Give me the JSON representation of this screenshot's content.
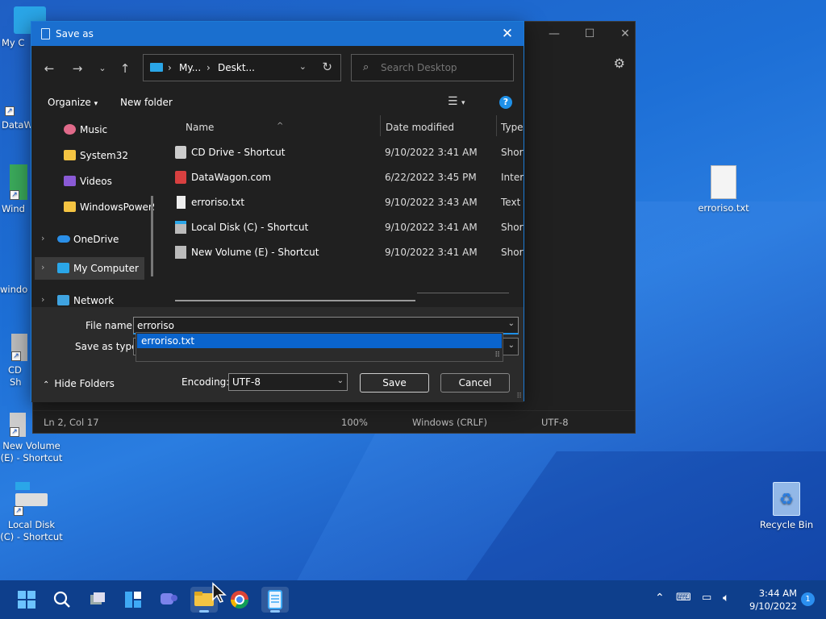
{
  "desktop": {
    "icons": [
      {
        "label": "My Computer",
        "partial": "My C"
      },
      {
        "label": "DataWagon.com",
        "partial": "DataW"
      },
      {
        "label": "WindowsPowerShell",
        "partial": "Wind"
      },
      {
        "label": "windows",
        "partial": "windo"
      },
      {
        "label": "CD Drive - Shortcut",
        "partial1": "CD",
        "partial2": "Sh"
      },
      {
        "label": "New Volume (E) - Shortcut"
      },
      {
        "label": "Local Disk (C) - Shortcut"
      },
      {
        "label": "erroriso.txt"
      },
      {
        "label": "Recycle Bin"
      }
    ]
  },
  "notepad": {
    "status": {
      "position": "Ln 2, Col 17",
      "zoom": "100%",
      "line_endings": "Windows (CRLF)",
      "encoding": "UTF-8"
    }
  },
  "dialog": {
    "title": "Save as",
    "address": {
      "crumb1": "My...",
      "crumb2": "Deskt..."
    },
    "search_placeholder": "Search Desktop",
    "commands": {
      "organize": "Organize",
      "new_folder": "New folder"
    },
    "nav_items": [
      {
        "label": "Music",
        "icon": "music-icon"
      },
      {
        "label": "System32",
        "icon": "folder-icon"
      },
      {
        "label": "Videos",
        "icon": "videos-icon"
      },
      {
        "label": "WindowsPowerShell",
        "icon": "folder-icon"
      },
      {
        "label": "OneDrive",
        "icon": "onedrive-icon"
      },
      {
        "label": "My Computer",
        "icon": "computer-icon"
      },
      {
        "label": "Network",
        "icon": "network-icon"
      }
    ],
    "columns": {
      "name": "Name",
      "date": "Date modified",
      "type": "Type"
    },
    "files": [
      {
        "name": "CD Drive - Shortcut",
        "date": "9/10/2022 3:41 AM",
        "type": "Short"
      },
      {
        "name": "DataWagon.com",
        "date": "6/22/2022 3:45 PM",
        "type": "Intern"
      },
      {
        "name": "erroriso.txt",
        "date": "9/10/2022 3:43 AM",
        "type": "Text D"
      },
      {
        "name": "Local Disk (C) - Shortcut",
        "date": "9/10/2022 3:41 AM",
        "type": "Short"
      },
      {
        "name": "New Volume (E) - Shortcut",
        "date": "9/10/2022 3:41 AM",
        "type": "Short"
      }
    ],
    "file_name_label": "File name:",
    "file_name_value": "erroriso",
    "save_as_type_label": "Save as type:",
    "autocomplete_option": "erroriso.txt",
    "hide_folders": "Hide Folders",
    "encoding_label": "Encoding:",
    "encoding_value": "UTF-8",
    "save_button": "Save",
    "cancel_button": "Cancel"
  },
  "taskbar": {
    "clock_time": "3:44 AM",
    "clock_date": "9/10/2022",
    "notification_count": "1"
  },
  "colors": {
    "accent": "#1a6fcf",
    "taskbar": "#0e3f8c",
    "dialog_bg": "#202020"
  }
}
